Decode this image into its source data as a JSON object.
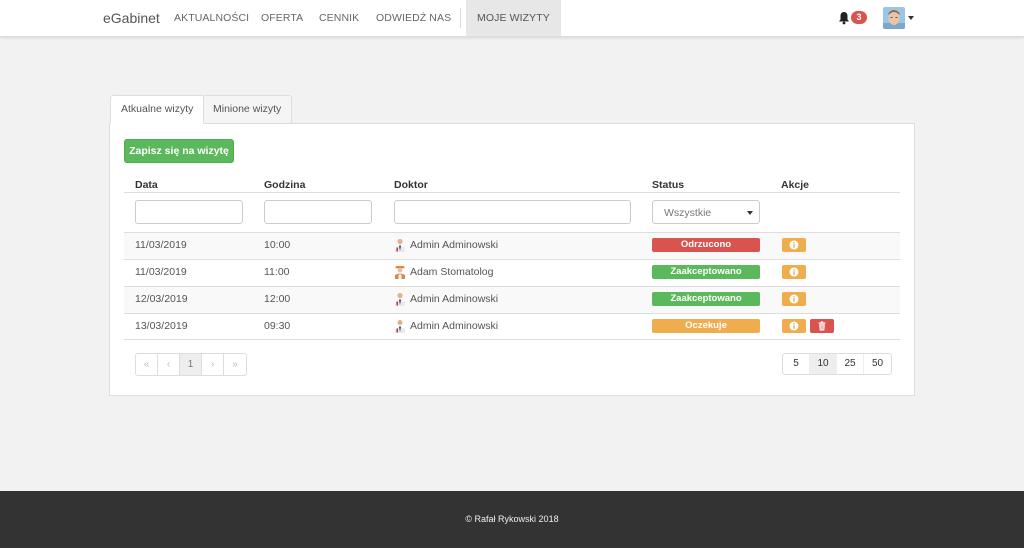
{
  "nav": {
    "brand": "eGabinet",
    "items": [
      "AKTUALNOŚCI",
      "OFERTA",
      "CENNIK",
      "ODWIEDŹ NAS",
      "MOJE WIZYTY"
    ],
    "notification_count": "3"
  },
  "tabs": [
    "Atkualne wizyty",
    "Minione wizyty"
  ],
  "add_button": "Zapisz się na wizytę",
  "table": {
    "headers": [
      "Data",
      "Godzina",
      "Doktor",
      "Status",
      "Akcje"
    ],
    "status_filter": "Wszystkie",
    "rows": [
      {
        "date": "11/03/2019",
        "time": "10:00",
        "doctor": "Admin Adminowski",
        "status": "Odrzucono"
      },
      {
        "date": "11/03/2019",
        "time": "11:00",
        "doctor": "Adam Stomatolog",
        "status": "Zaakceptowano"
      },
      {
        "date": "12/03/2019",
        "time": "12:00",
        "doctor": "Admin Adminowski",
        "status": "Zaakceptowano"
      },
      {
        "date": "13/03/2019",
        "time": "09:30",
        "doctor": "Admin Adminowski",
        "status": "Oczekuje"
      }
    ]
  },
  "pagination": {
    "first": "«",
    "prev": "‹",
    "current": "1",
    "next": "›",
    "last": "»"
  },
  "page_sizes": [
    "5",
    "10",
    "25",
    "50"
  ],
  "footer": "© Rafał Rykowski 2018",
  "colors": {
    "rejected": "#d9534f",
    "accepted": "#5cb85c",
    "pending": "#f0ad4e",
    "footer": "#333333"
  }
}
